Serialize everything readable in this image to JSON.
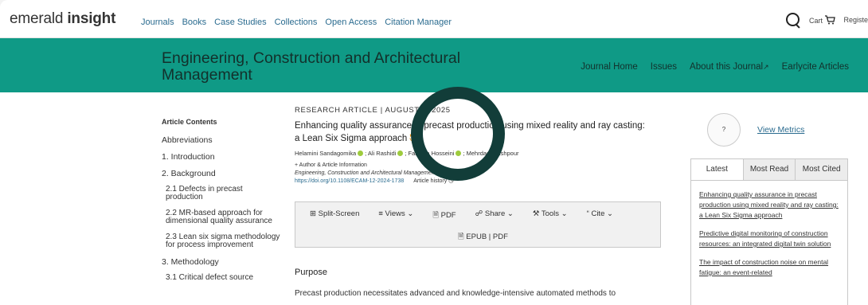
{
  "header": {
    "logo_light": "emerald",
    "logo_bold": "insight",
    "nav": [
      "Journals",
      "Books",
      "Case Studies",
      "Collections",
      "Open Access",
      "Citation Manager"
    ],
    "cart_label": "Cart",
    "register_label": "Registe"
  },
  "band": {
    "journal_title": "Engineering, Construction and Architectural Management",
    "links": [
      "Journal Home",
      "Issues",
      "About this Journal",
      "Earlycite Articles"
    ]
  },
  "toc": {
    "heading": "Article Contents",
    "items": [
      "Abbreviations",
      "1. Introduction",
      "2. Background",
      "2.1 Defects in precast production",
      "2.2 MR-based approach for dimensional quality assurance",
      "2.3 Lean six sigma methodology for process improvement",
      "3. Methodology",
      "3.1 Critical defect source"
    ]
  },
  "article": {
    "kicker": "RESEARCH ARTICLE |  AUGUST 2, 2025",
    "title": "Enhancing quality assurance in precast production using mixed reality and ray casting: a Lean Six Sigma approach",
    "authors": [
      "Helamini Sandagomika",
      "Ali Rashidi",
      "Farzeza Hosseini",
      "Mehrdad Arashpour"
    ],
    "author_info": "+ Author & Article Information",
    "journal": "Engineering, Construction and Architectural Management (2025)",
    "doi": "https://doi.org/10.1108/ECAM-12-2024-1738",
    "history": "Article history"
  },
  "toolbar": {
    "split": "Split-Screen",
    "views": "Views",
    "pdf": "PDF",
    "share": "Share",
    "tools": "Tools",
    "cite": "Cite",
    "epub": "EPUB | PDF"
  },
  "sections": {
    "purpose": "Purpose",
    "abstract": "Precast production necessitates advanced and knowledge-intensive automated methods to"
  },
  "metrics": {
    "badge": "?",
    "view": "View Metrics"
  },
  "side_tabs": [
    "Latest",
    "Most Read",
    "Most Cited"
  ],
  "latest": [
    "Enhancing quality assurance in precast production using mixed reality and ray casting: a Lean Six Sigma approach",
    "Predictive digital monitoring of construction resources: an integrated digital twin solution",
    "The impact of construction noise on mental fatigue: an event-related"
  ],
  "colors": {
    "teal_band": "#0f9a86",
    "ring": "#123d39",
    "link": "#2a6b8f"
  }
}
